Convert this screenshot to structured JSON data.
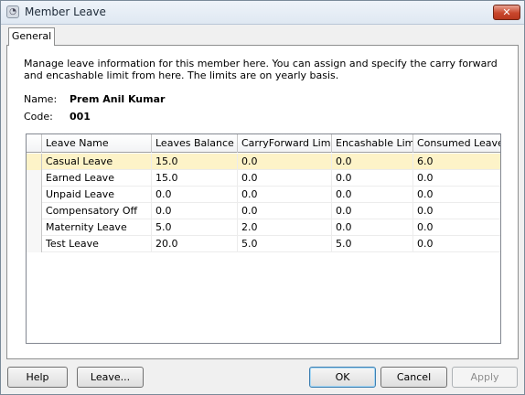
{
  "window": {
    "title": "Member Leave",
    "close_label": "✕"
  },
  "tabs": [
    {
      "label": "General"
    }
  ],
  "description": "Manage leave information for this member here. You can assign and specify the carry forward and encashable limit from here. The limits are on yearly basis.",
  "member": {
    "name_label": "Name:",
    "name_value": "Prem Anil Kumar",
    "code_label": "Code:",
    "code_value": "001"
  },
  "grid": {
    "columns": [
      "Leave Name",
      "Leaves Balance",
      "CarryForward Limit",
      "Encashable Limit",
      "Consumed Leave"
    ],
    "rows": [
      [
        "Casual Leave",
        "15.0",
        "0.0",
        "0.0",
        "6.0"
      ],
      [
        "Earned Leave",
        "15.0",
        "0.0",
        "0.0",
        "0.0"
      ],
      [
        "Unpaid Leave",
        "0.0",
        "0.0",
        "0.0",
        "0.0"
      ],
      [
        "Compensatory Off",
        "0.0",
        "0.0",
        "0.0",
        "0.0"
      ],
      [
        "Maternity Leave",
        "5.0",
        "2.0",
        "0.0",
        "0.0"
      ],
      [
        "Test Leave",
        "20.0",
        "5.0",
        "5.0",
        "0.0"
      ]
    ],
    "selected_row": 0
  },
  "buttons": {
    "help": "Help",
    "leave": "Leave...",
    "ok": "OK",
    "cancel": "Cancel",
    "apply": "Apply"
  }
}
